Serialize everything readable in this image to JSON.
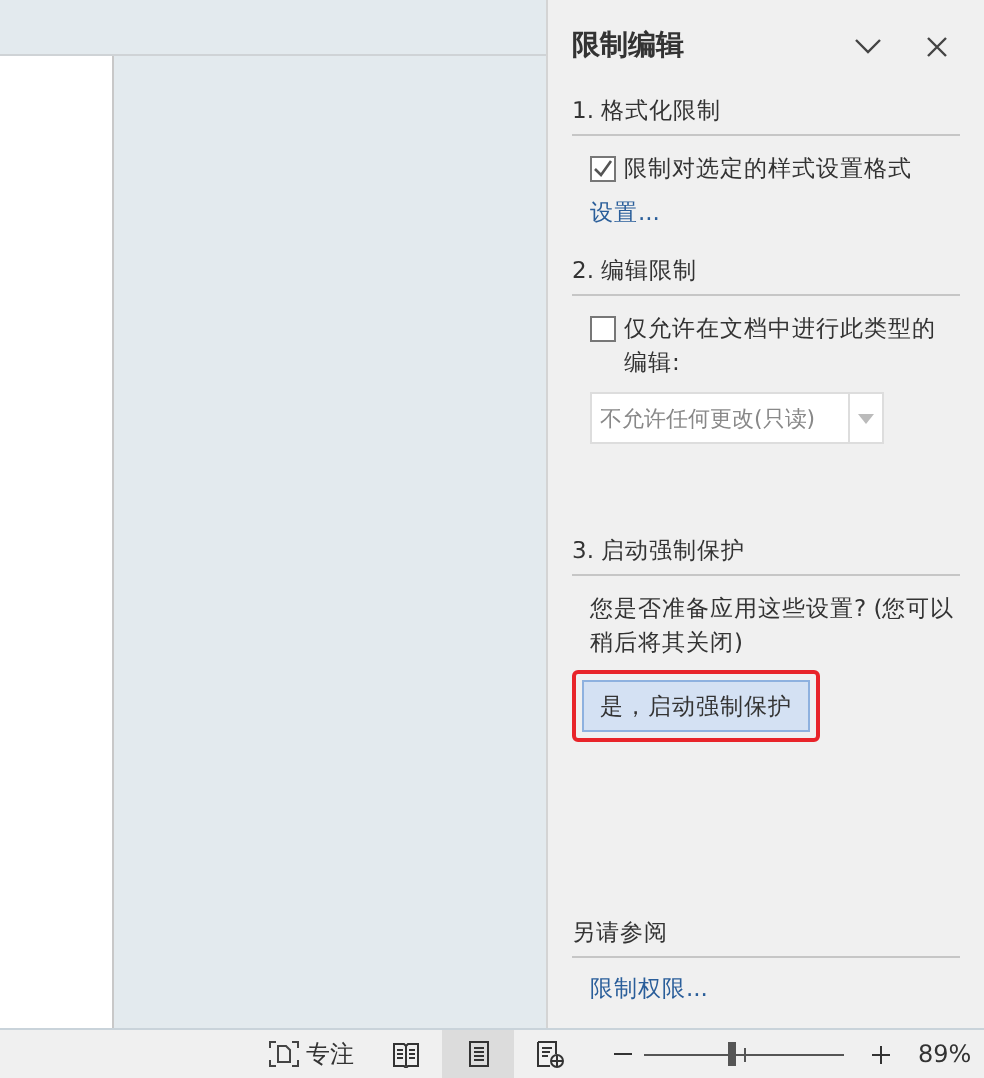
{
  "pane": {
    "title": "限制编辑",
    "sections": [
      {
        "heading": "1. 格式化限制",
        "checkbox": {
          "label": "限制对选定的样式设置格式",
          "checked": true
        },
        "link": "设置..."
      },
      {
        "heading": "2. 编辑限制",
        "checkbox": {
          "label": "仅允许在文档中进行此类型的编辑:",
          "checked": false
        },
        "dropdown": {
          "value": "不允许任何更改(只读)",
          "disabled": true
        }
      },
      {
        "heading": "3. 启动强制保护",
        "text": "您是否准备应用这些设置? (您可以稍后将其关闭)",
        "button": {
          "label": "是，启动强制保护",
          "highlighted": true
        }
      }
    ],
    "see_also": {
      "heading": "另请参阅",
      "link": "限制权限..."
    }
  },
  "status_bar": {
    "focus": "专注",
    "views": [
      {
        "kind": "read",
        "selected": false
      },
      {
        "kind": "print",
        "selected": true
      },
      {
        "kind": "web",
        "selected": false
      }
    ],
    "zoom": {
      "level": 0.44,
      "reading": "89%"
    }
  }
}
